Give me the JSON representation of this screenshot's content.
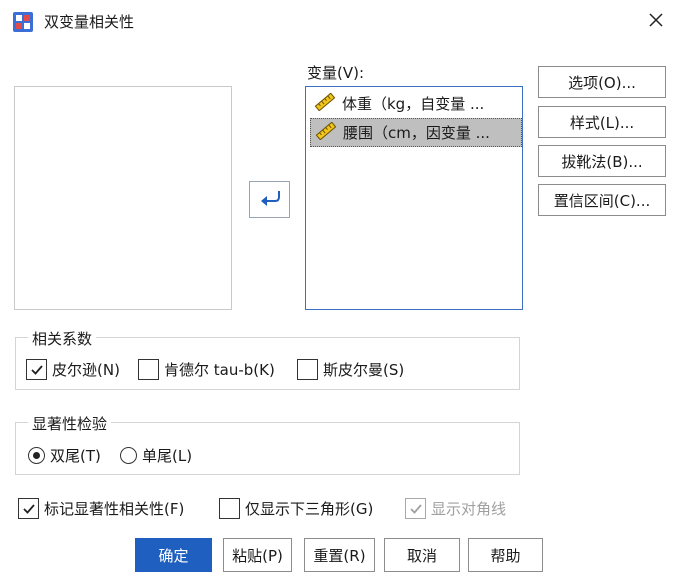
{
  "window": {
    "title": "双变量相关性",
    "icon": "correlation-app-icon",
    "close_icon": "close-icon"
  },
  "variables": {
    "label": "变量(V):",
    "items": [
      {
        "label": "体重（kg，自变量 ...",
        "icon": "ruler-scale-icon",
        "selected": false
      },
      {
        "label": "腰围（cm，因变量 ...",
        "icon": "ruler-scale-icon",
        "selected": true
      }
    ]
  },
  "move_button_icon": "arrow-left-icon",
  "side_buttons": {
    "options": "选项(O)...",
    "style": "样式(L)...",
    "bootstrap": "拔靴法(B)...",
    "confidence": "置信区间(C)..."
  },
  "correlation": {
    "legend": "相关系数",
    "pearson": {
      "label": "皮尔逊(N)",
      "checked": true
    },
    "kendall": {
      "label": "肯德尔 tau-b(K)",
      "checked": false
    },
    "spearman": {
      "label": "斯皮尔曼(S)",
      "checked": false
    }
  },
  "significance": {
    "legend": "显著性检验",
    "two_tailed": {
      "label": "双尾(T)",
      "selected": true
    },
    "one_tailed": {
      "label": "单尾(L)",
      "selected": false
    }
  },
  "flags": {
    "flag_significant": {
      "label": "标记显著性相关性(F)",
      "checked": true
    },
    "lower_triangle": {
      "label": "仅显示下三角形(G)",
      "checked": false
    },
    "show_diagonal": {
      "label": "显示对角线",
      "checked": true,
      "disabled": true
    }
  },
  "buttons": {
    "ok": "确定",
    "paste": "粘贴(P)",
    "reset": "重置(R)",
    "cancel": "取消",
    "help": "帮助"
  },
  "colors": {
    "primary": "#1f5fbf",
    "list_focus": "#3a6fc4",
    "selection": "#bfbfbf",
    "disabled": "#a0a0a0"
  }
}
